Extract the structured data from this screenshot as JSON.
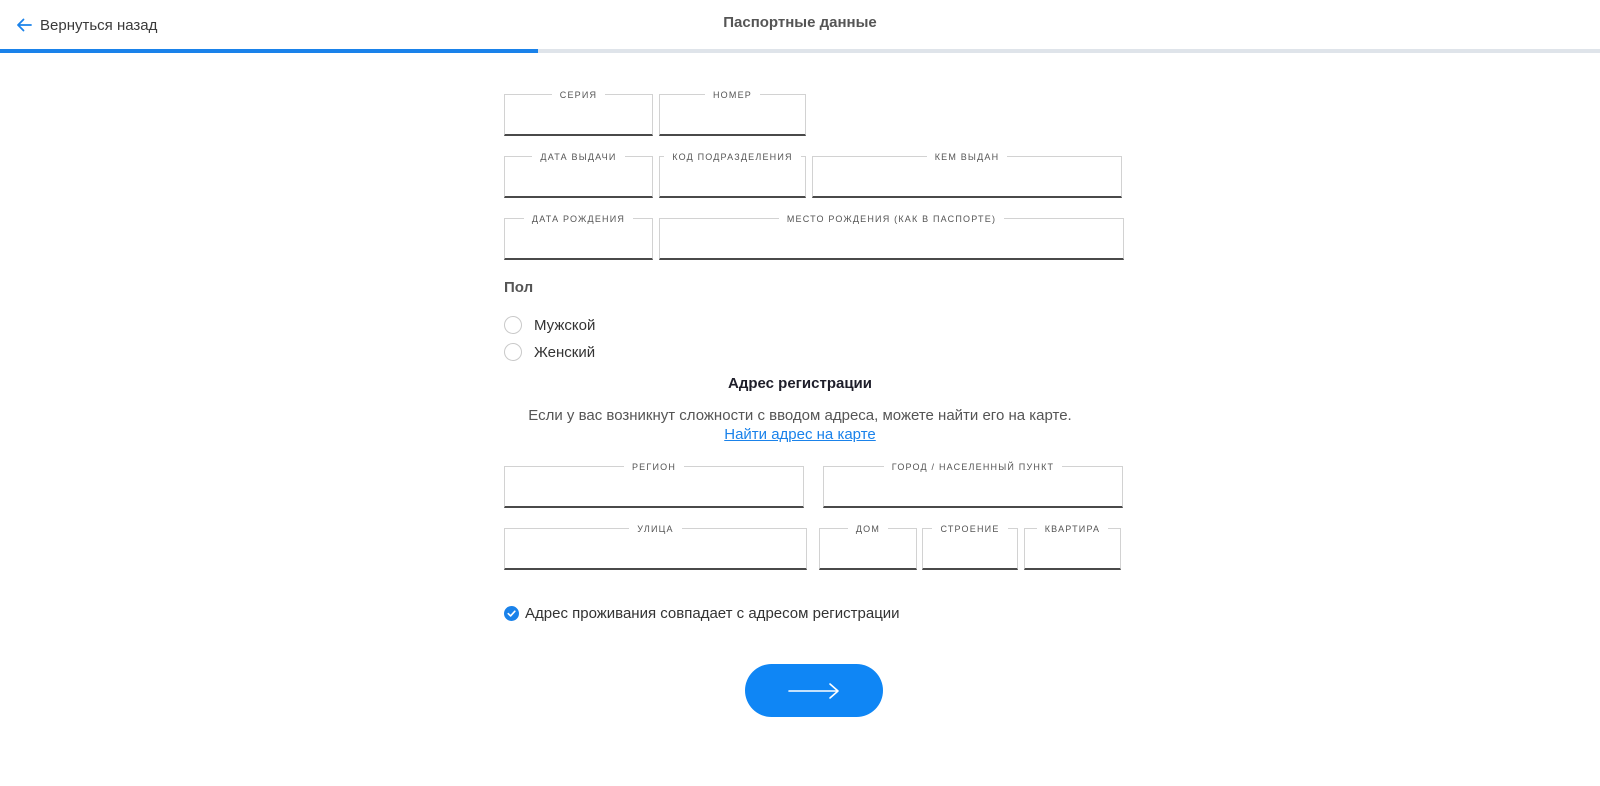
{
  "header": {
    "back_label": "Вернуться назад",
    "title": "Паспортные данные",
    "progress_fraction": 0.336,
    "accent_color": "#1a82ea"
  },
  "passport": {
    "series": {
      "caption": "СЕРИЯ",
      "value": ""
    },
    "number": {
      "caption": "НОМЕР",
      "value": ""
    },
    "issue_date": {
      "caption": "ДАТА ВЫДАЧИ",
      "value": ""
    },
    "department_code": {
      "caption": "КОД ПОДРАЗДЕЛЕНИЯ",
      "value": ""
    },
    "issued_by": {
      "caption": "КЕМ ВЫДАН",
      "value": ""
    },
    "birth_date": {
      "caption": "ДАТА РОЖДЕНИЯ",
      "value": ""
    },
    "birth_place": {
      "caption": "МЕСТО РОЖДЕНИЯ (КАК В ПАСПОРТЕ)",
      "value": ""
    }
  },
  "gender": {
    "label": "Пол",
    "options": [
      "Мужской",
      "Женский"
    ],
    "selected": null
  },
  "registration": {
    "title": "Адрес регистрации",
    "hint": "Если у вас возникнут сложности с вводом адреса, можете найти его на карте.",
    "map_link": "Найти адрес на карте",
    "region": {
      "caption": "РЕГИОН",
      "value": ""
    },
    "city": {
      "caption": "ГОРОД / НАСЕЛЕННЫЙ ПУНКТ",
      "value": ""
    },
    "street": {
      "caption": "УЛИЦА",
      "value": ""
    },
    "house": {
      "caption": "ДОМ",
      "value": ""
    },
    "building": {
      "caption": "СТРОЕНИЕ",
      "value": ""
    },
    "apartment": {
      "caption": "КВАРТИРА",
      "value": ""
    }
  },
  "same_address": {
    "label": "Адрес проживания совпадает с адресом регистрации",
    "checked": true
  },
  "next_button": {
    "icon": "arrow-right-icon",
    "color": "#0f86f5"
  }
}
